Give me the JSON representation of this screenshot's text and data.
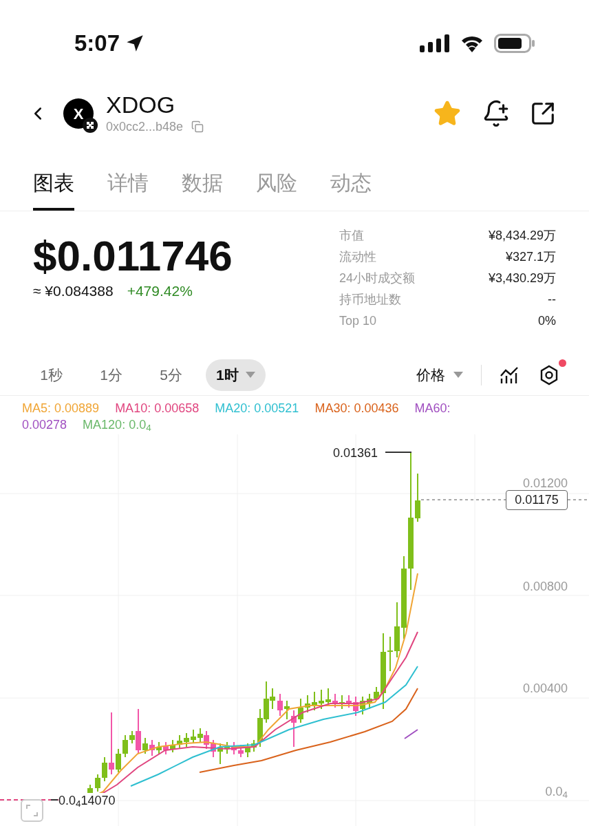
{
  "status_bar": {
    "time": "5:07"
  },
  "header": {
    "logo_text": "X",
    "title": "XDOG",
    "address": "0x0cc2...b48e",
    "favorite": true
  },
  "tabs": [
    {
      "label": "图表",
      "selected": true
    },
    {
      "label": "详情",
      "selected": false
    },
    {
      "label": "数据",
      "selected": false
    },
    {
      "label": "风险",
      "selected": false
    },
    {
      "label": "动态",
      "selected": false
    }
  ],
  "price": {
    "value": "$0.011746",
    "converted": "≈ ¥0.084388",
    "change": "+479.42%"
  },
  "stats": [
    {
      "label": "市值",
      "value": "¥8,434.29万"
    },
    {
      "label": "流动性",
      "value": "¥327.1万"
    },
    {
      "label": "24小时成交额",
      "value": "¥3,430.29万"
    },
    {
      "label": "持币地址数",
      "value": "--"
    },
    {
      "label": "Top 10",
      "value": "0%"
    }
  ],
  "intervals": [
    {
      "label": "1秒",
      "selected": false
    },
    {
      "label": "1分",
      "selected": false
    },
    {
      "label": "5分",
      "selected": false
    },
    {
      "label": "1时",
      "selected": true
    }
  ],
  "chart_toolbar": {
    "price_mode": "价格",
    "settings_badge": true
  },
  "ma_legend": [
    {
      "name": "MA5:",
      "value": "0.00889",
      "color": "#f0a535"
    },
    {
      "name": "MA10:",
      "value": "0.00658",
      "color": "#e0457f"
    },
    {
      "name": "MA20:",
      "value": "0.00521",
      "color": "#2ebfd0"
    },
    {
      "name": "MA30:",
      "value": "0.00436",
      "color": "#d9621b"
    },
    {
      "name": "MA60:",
      "value": "0.00278",
      "color": "#a04fc0"
    },
    {
      "name": "MA120:",
      "value": "0.0$_{4}$",
      "color": "#6ab86a"
    }
  ],
  "chart": {
    "y_labels": [
      "0.01200",
      "0.00800",
      "0.00400",
      "0.0$_{4}$"
    ],
    "high_label": "0.01361",
    "low_label": "0.0$_{4}$14070",
    "last_price": "0.01175"
  }
}
